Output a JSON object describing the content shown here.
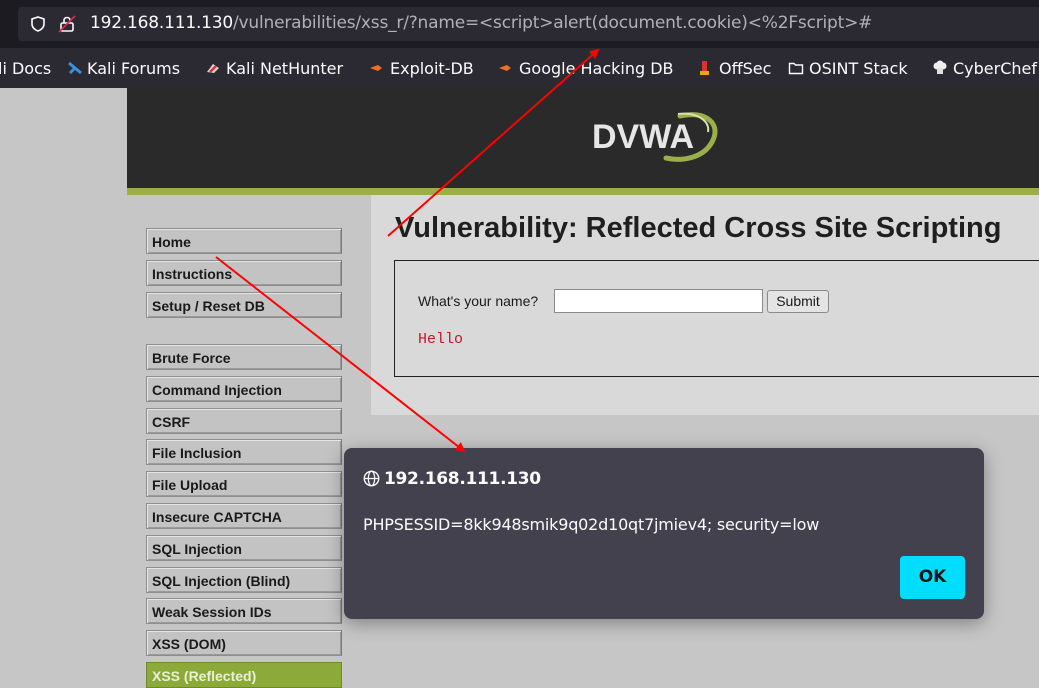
{
  "browser": {
    "url_host": "192.168.111.130",
    "url_path": "/vulnerabilities/xss_r/?name=<script>alert(document.cookie)<%2Fscript>#",
    "bookmarks": [
      {
        "label": "li Docs",
        "icon": "kali-docs-icon"
      },
      {
        "label": "Kali Forums",
        "icon": "kali-forums-icon"
      },
      {
        "label": "Kali NetHunter",
        "icon": "nethunter-icon"
      },
      {
        "label": "Exploit-DB",
        "icon": "exploit-db-icon"
      },
      {
        "label": "Google Hacking DB",
        "icon": "ghdb-icon"
      },
      {
        "label": "OffSec",
        "icon": "offsec-icon"
      },
      {
        "label": "OSINT Stack",
        "icon": "folder-icon"
      },
      {
        "label": "CyberChef",
        "icon": "cyberchef-icon"
      }
    ]
  },
  "header": {
    "logo_text": "DVWA"
  },
  "sidebar": {
    "items": [
      {
        "label": "Home"
      },
      {
        "label": "Instructions"
      },
      {
        "label": "Setup / Reset DB"
      },
      {
        "label": "Brute Force"
      },
      {
        "label": "Command Injection"
      },
      {
        "label": "CSRF"
      },
      {
        "label": "File Inclusion"
      },
      {
        "label": "File Upload"
      },
      {
        "label": "Insecure CAPTCHA"
      },
      {
        "label": "SQL Injection"
      },
      {
        "label": "SQL Injection (Blind)"
      },
      {
        "label": "Weak Session IDs"
      },
      {
        "label": "XSS (DOM)"
      },
      {
        "label": "XSS (Reflected)",
        "active": true
      }
    ]
  },
  "main": {
    "title": "Vulnerability: Reflected Cross Site Scripting",
    "form_label": "What's your name?",
    "name_value": "",
    "submit_label": "Submit",
    "result": "Hello"
  },
  "dialog": {
    "host": "192.168.111.130",
    "message": "PHPSESSID=8kk948smik9q02d10qt7jmiev4; security=low",
    "ok_label": "OK"
  },
  "colors": {
    "accent_active": "#8caa3a",
    "ok_button": "#00ddff",
    "annotation_arrow": "#ff0000"
  }
}
